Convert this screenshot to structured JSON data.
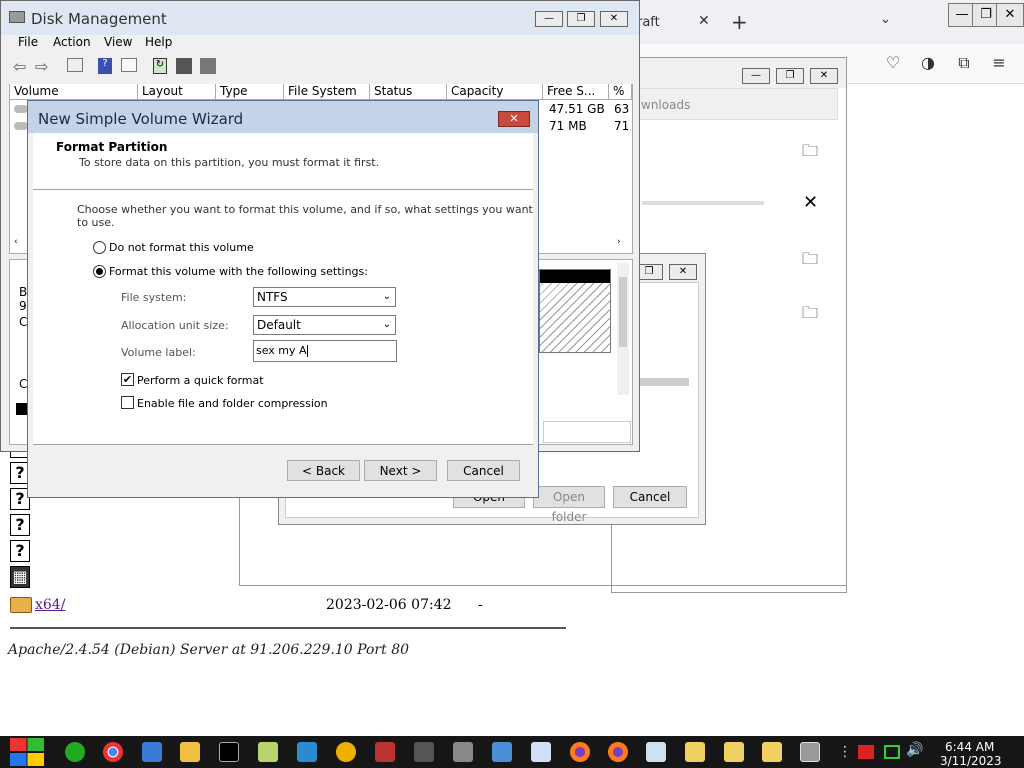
{
  "browser": {
    "tab_title": "raft",
    "toolbar_text": "wnloads"
  },
  "listing": {
    "row_name": "x64/",
    "row_date": "2023-02-06 07:42",
    "row_size": "-",
    "footer": "Apache/2.4.54 (Debian) Server at 91.206.229.10 Port 80",
    "partial_letters": [
      "B",
      "9",
      "C",
      "C"
    ]
  },
  "picker": {
    "open_label": "Open",
    "open_folder_label": "Open folder",
    "cancel_label": "Cancel"
  },
  "disk_management": {
    "title": "Disk Management",
    "menu": [
      "File",
      "Action",
      "View",
      "Help"
    ],
    "columns": [
      "Volume",
      "Layout",
      "Type",
      "File System",
      "Status",
      "Capacity",
      "Free S...",
      "%"
    ],
    "rows": [
      {
        "free": "47.51 GB",
        "pct": "63"
      },
      {
        "free": "71 MB",
        "pct": "71"
      }
    ]
  },
  "wizard": {
    "title": "New Simple Volume Wizard",
    "heading": "Format Partition",
    "subheading": "To store data on this partition, you must format it first.",
    "instruction": "Choose whether you want to format this volume, and if so, what settings you want to use.",
    "radio_no_format": "Do not format this volume",
    "radio_format": "Format this volume with the following settings:",
    "fs_label": "File system:",
    "fs_value": "NTFS",
    "alloc_label": "Allocation unit size:",
    "alloc_value": "Default",
    "vol_label": "Volume label:",
    "vol_value": "sex my A",
    "quick_format": "Perform a quick format",
    "compression": "Enable file and folder compression",
    "back": "< Back",
    "next": "Next >",
    "cancel": "Cancel"
  },
  "taskbar": {
    "time": "6:44 AM",
    "date": "3/11/2023"
  }
}
